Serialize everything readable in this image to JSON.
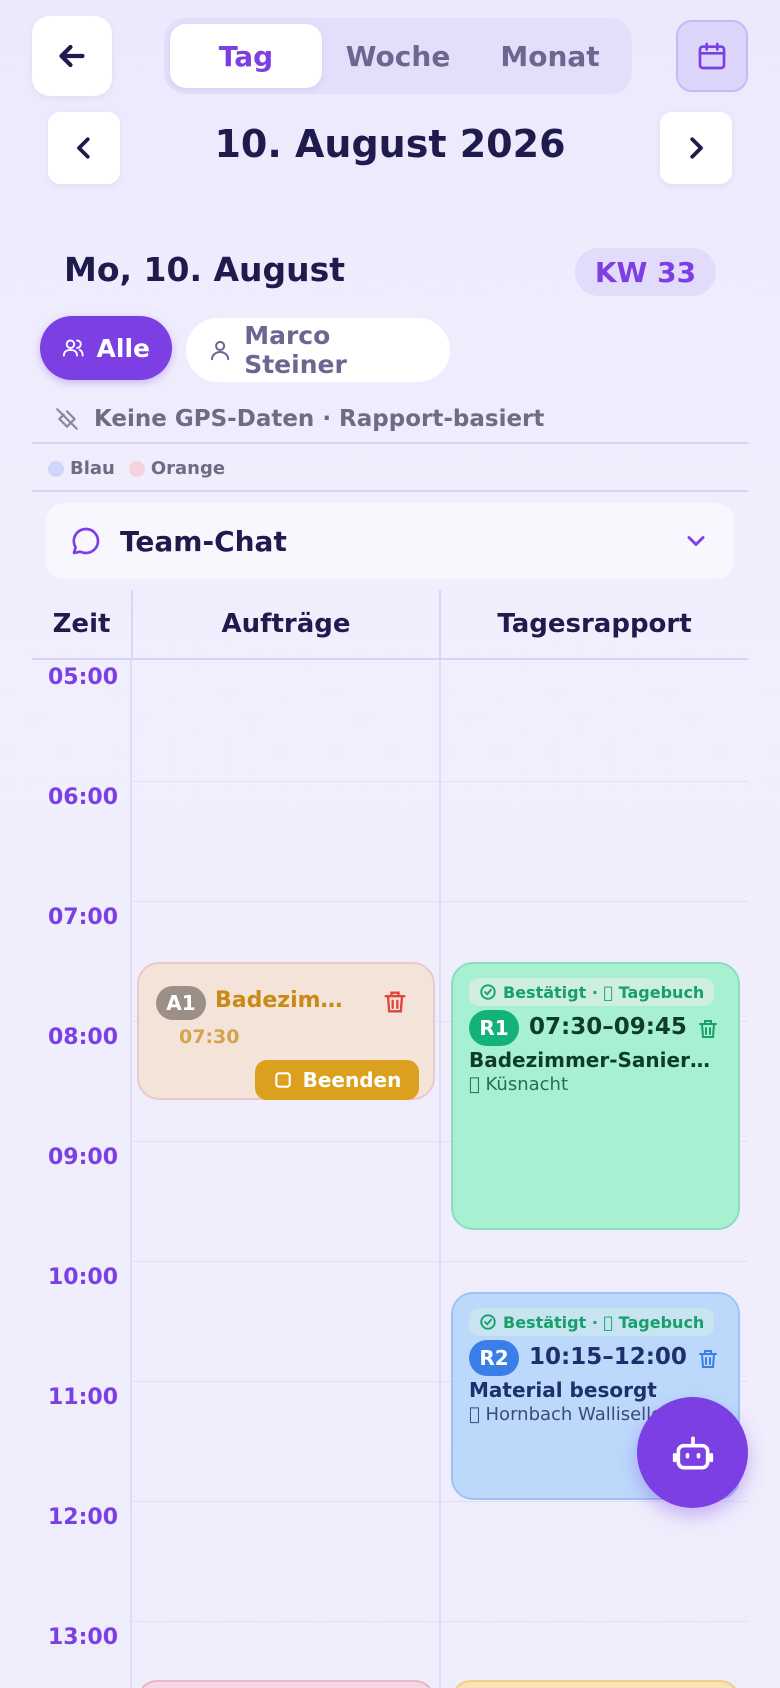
{
  "header": {
    "tabs": [
      {
        "label": "Tag",
        "active": true
      },
      {
        "label": "Woche",
        "active": false
      },
      {
        "label": "Monat",
        "active": false
      }
    ],
    "date_title": "10. August 2026"
  },
  "day": {
    "title": "Mo, 10. August",
    "week_badge": "KW 33"
  },
  "filters": {
    "all_label": "Alle",
    "user_label": "Marco Steiner"
  },
  "gps_notice": "Keine GPS-Daten · Rapport-basiert",
  "legend": [
    {
      "label": "Blau",
      "color": "#cfd6fb"
    },
    {
      "label": "Orange",
      "color": "#f5d3dc"
    }
  ],
  "chat": {
    "title": "Team-Chat"
  },
  "grid": {
    "col_time": "Zeit",
    "col_orders": "Aufträge",
    "col_reports": "Tagesrapport",
    "times": [
      "05:00",
      "06:00",
      "07:00",
      "08:00",
      "09:00",
      "10:00",
      "11:00",
      "12:00",
      "13:00"
    ]
  },
  "order_card": {
    "badge": "A1",
    "title": "Badezim…",
    "time": "07:30",
    "action": "Beenden"
  },
  "report_cards": [
    {
      "status": "Bestätigt · 󰁏 Tagebuch",
      "badge": "R1",
      "time": "07:30–09:45",
      "title": "Badezimmer-Sanier…",
      "location": "󰍎 Küsnacht"
    },
    {
      "status": "Bestätigt · 󰁏 Tagebuch",
      "badge": "R2",
      "time": "10:15–12:00",
      "title": "Material besorgt",
      "location": "󰍎 Hornbach Wallisellen"
    }
  ],
  "colors": {
    "accent": "#7b3fe4",
    "order_bg": "#f3e3d8",
    "order_text": "#c98a16",
    "report1_bg": "#a8f0d2",
    "report2_bg": "#bcd9fb"
  }
}
